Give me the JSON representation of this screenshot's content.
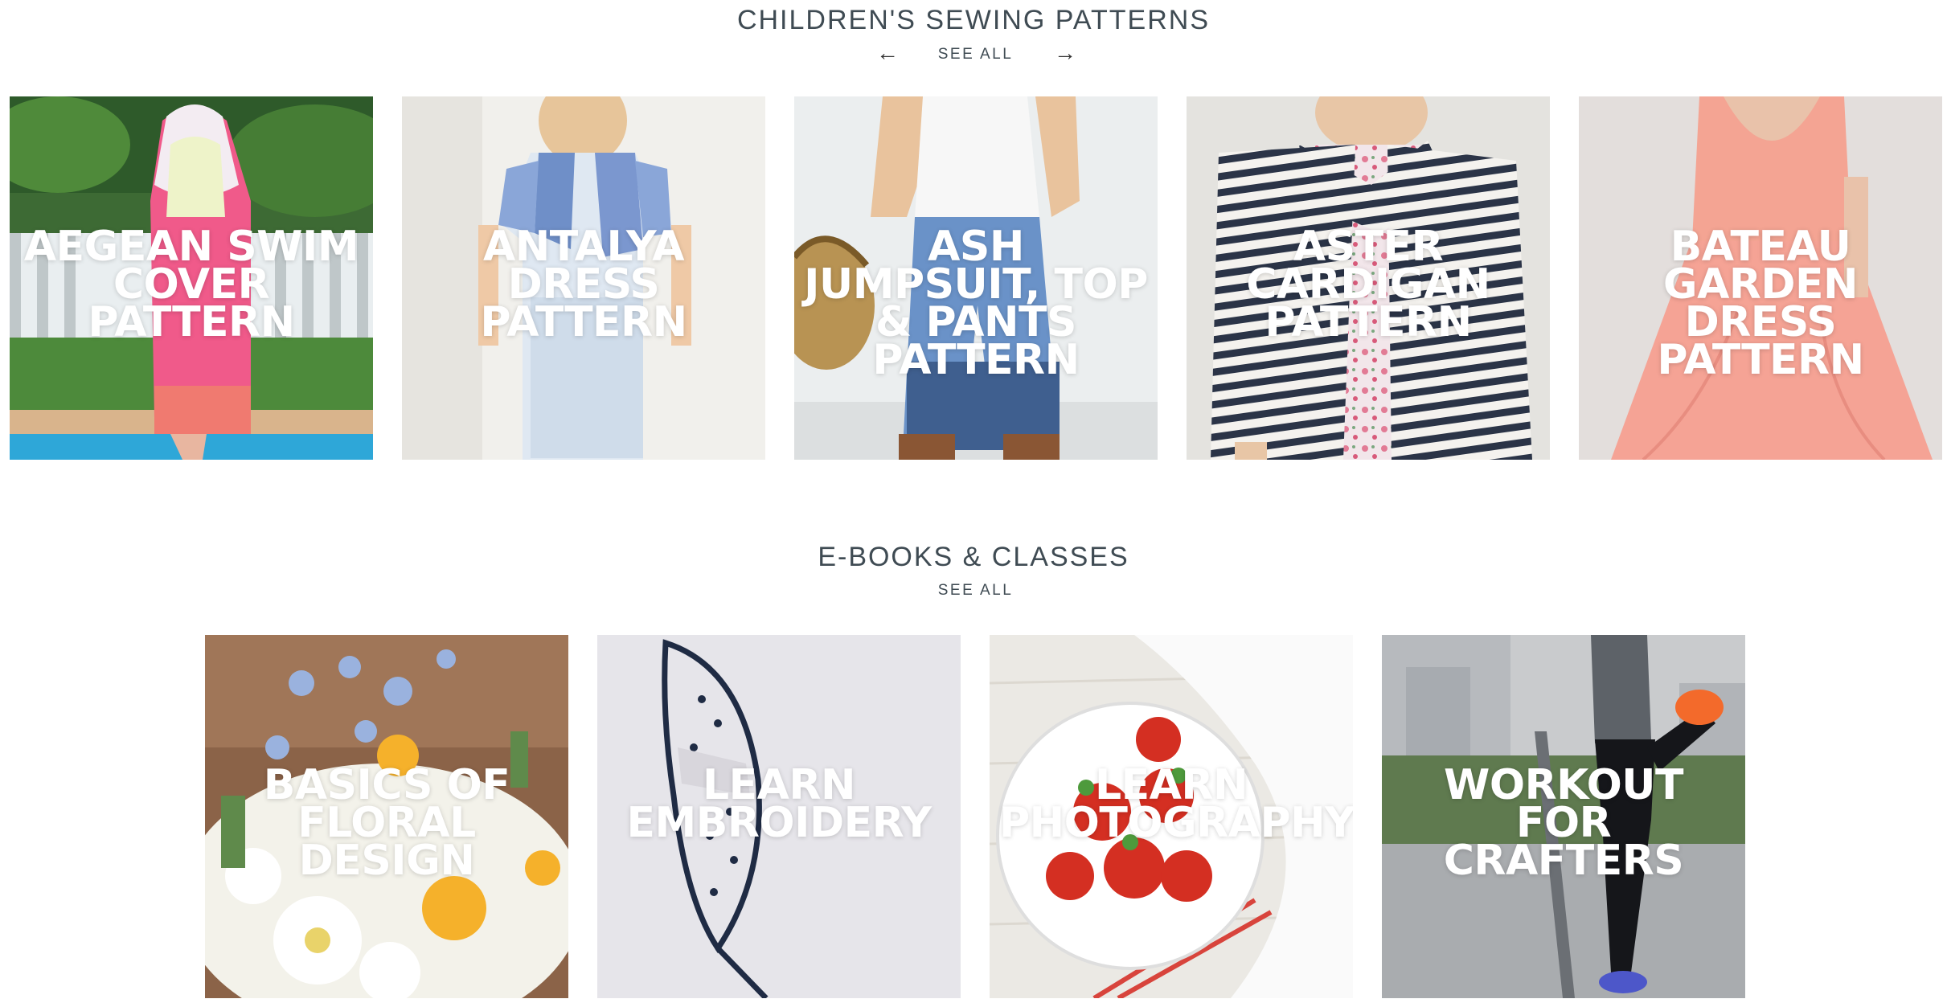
{
  "sections": {
    "patterns": {
      "title": "CHILDREN'S SEWING PATTERNS",
      "see_all": "SEE ALL",
      "prev_icon": "←",
      "next_icon": "→",
      "items": [
        {
          "label": "AEGEAN SWIM COVER PATTERN"
        },
        {
          "label": "ANTALYA DRESS PATTERN"
        },
        {
          "label": "ASH JUMPSUIT, TOP & PANTS PATTERN"
        },
        {
          "label": "ASTER CARDIGAN PATTERN"
        },
        {
          "label": "BATEAU GARDEN DRESS PATTERN"
        }
      ]
    },
    "ebooks": {
      "title": "E-BOOKS & CLASSES",
      "see_all": "SEE ALL",
      "items": [
        {
          "label": "BASICS OF FLORAL DESIGN"
        },
        {
          "label": "LEARN EMBROIDERY"
        },
        {
          "label": "LEARN PHOTOGRAPHY"
        },
        {
          "label": "WORKOUT FOR CRAFTERS"
        }
      ]
    }
  }
}
